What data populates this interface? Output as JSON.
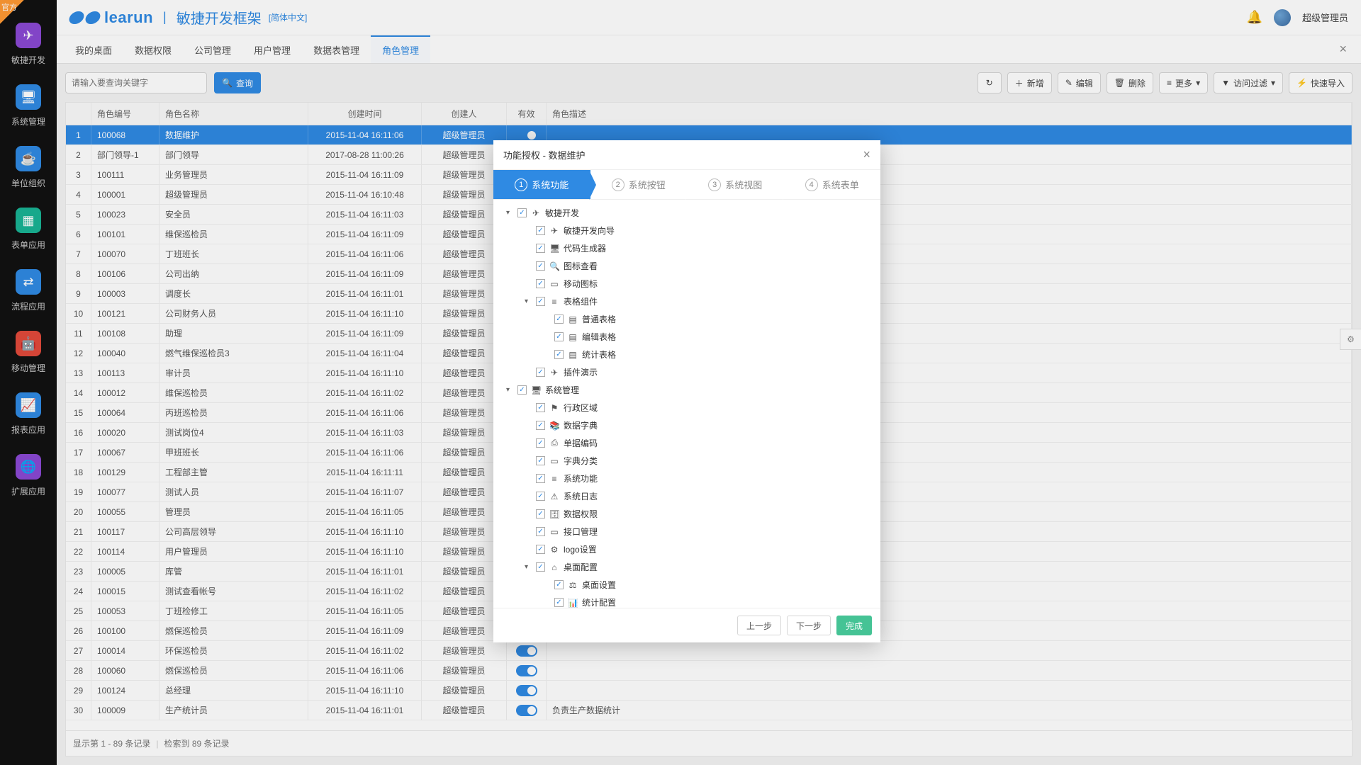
{
  "brand": {
    "name": "learun",
    "cn": "敏捷开发框架",
    "lang": "[简体中文]",
    "official": "官方"
  },
  "user": {
    "name": "超级管理员"
  },
  "sidebar": [
    {
      "label": "敏捷开发",
      "color": "#8b49d4",
      "icon": "send-icon",
      "glyph": "✈"
    },
    {
      "label": "系统管理",
      "color": "#2f8ae3",
      "icon": "monitor-icon",
      "glyph": "🖥"
    },
    {
      "label": "单位组织",
      "color": "#2f8ae3",
      "icon": "coffee-icon",
      "glyph": "☕"
    },
    {
      "label": "表单应用",
      "color": "#19b394",
      "icon": "grid-icon",
      "glyph": "▦"
    },
    {
      "label": "流程应用",
      "color": "#2f8ae3",
      "icon": "share-icon",
      "glyph": "⇄"
    },
    {
      "label": "移动管理",
      "color": "#e24a3b",
      "icon": "android-icon",
      "glyph": "🤖"
    },
    {
      "label": "报表应用",
      "color": "#2f8ae3",
      "icon": "chart-icon",
      "glyph": "📈"
    },
    {
      "label": "扩展应用",
      "color": "#8b49d4",
      "icon": "globe-icon",
      "glyph": "🌐"
    }
  ],
  "tabs": [
    "我的桌面",
    "数据权限",
    "公司管理",
    "用户管理",
    "数据表管理",
    "角色管理"
  ],
  "activeTab": 5,
  "search": {
    "placeholder": "请输入要查询关键字",
    "btn": "查询"
  },
  "toolbar": {
    "refresh": "↻",
    "add": "新增",
    "edit": "编辑",
    "del": "删除",
    "more": "更多",
    "filter": "访问过滤",
    "quick": "快速导入"
  },
  "columns": {
    "idx": "",
    "code": "角色编号",
    "name": "角色名称",
    "time": "创建时间",
    "creator": "创建人",
    "valid": "有效",
    "desc": "角色描述"
  },
  "rows": [
    {
      "i": 1,
      "code": "100068",
      "name": "数据维护",
      "time": "2015-11-04 16:11:06",
      "creator": "超级管理员",
      "valid": true,
      "desc": ""
    },
    {
      "i": 2,
      "code": "部门领导-1",
      "name": "部门领导",
      "time": "2017-08-28 11:00:26",
      "creator": "超级管理员",
      "valid": true,
      "desc": ""
    },
    {
      "i": 3,
      "code": "100111",
      "name": "业务管理员",
      "time": "2015-11-04 16:11:09",
      "creator": "超级管理员",
      "valid": true,
      "desc": ""
    },
    {
      "i": 4,
      "code": "100001",
      "name": "超级管理员",
      "time": "2015-11-04 16:10:48",
      "creator": "超级管理员",
      "valid": true,
      "desc": ""
    },
    {
      "i": 5,
      "code": "100023",
      "name": "安全员",
      "time": "2015-11-04 16:11:03",
      "creator": "超级管理员",
      "valid": true,
      "desc": ""
    },
    {
      "i": 6,
      "code": "100101",
      "name": "维保巡检员",
      "time": "2015-11-04 16:11:09",
      "creator": "超级管理员",
      "valid": true,
      "desc": ""
    },
    {
      "i": 7,
      "code": "100070",
      "name": "丁班班长",
      "time": "2015-11-04 16:11:06",
      "creator": "超级管理员",
      "valid": true,
      "desc": ""
    },
    {
      "i": 8,
      "code": "100106",
      "name": "公司出纳",
      "time": "2015-11-04 16:11:09",
      "creator": "超级管理员",
      "valid": true,
      "desc": ""
    },
    {
      "i": 9,
      "code": "100003",
      "name": "调度长",
      "time": "2015-11-04 16:11:01",
      "creator": "超级管理员",
      "valid": true,
      "desc": ""
    },
    {
      "i": 10,
      "code": "100121",
      "name": "公司财务人员",
      "time": "2015-11-04 16:11:10",
      "creator": "超级管理员",
      "valid": true,
      "desc": ""
    },
    {
      "i": 11,
      "code": "100108",
      "name": "助理",
      "time": "2015-11-04 16:11:09",
      "creator": "超级管理员",
      "valid": true,
      "desc": ""
    },
    {
      "i": 12,
      "code": "100040",
      "name": "燃气维保巡检员3",
      "time": "2015-11-04 16:11:04",
      "creator": "超级管理员",
      "valid": true,
      "desc": ""
    },
    {
      "i": 13,
      "code": "100113",
      "name": "审计员",
      "time": "2015-11-04 16:11:10",
      "creator": "超级管理员",
      "valid": true,
      "desc": ""
    },
    {
      "i": 14,
      "code": "100012",
      "name": "维保巡检员",
      "time": "2015-11-04 16:11:02",
      "creator": "超级管理员",
      "valid": true,
      "desc": ""
    },
    {
      "i": 15,
      "code": "100064",
      "name": "丙班巡检员",
      "time": "2015-11-04 16:11:06",
      "creator": "超级管理员",
      "valid": true,
      "desc": ""
    },
    {
      "i": 16,
      "code": "100020",
      "name": "测试岗位4",
      "time": "2015-11-04 16:11:03",
      "creator": "超级管理员",
      "valid": true,
      "desc": ""
    },
    {
      "i": 17,
      "code": "100067",
      "name": "甲班班长",
      "time": "2015-11-04 16:11:06",
      "creator": "超级管理员",
      "valid": true,
      "desc": ""
    },
    {
      "i": 18,
      "code": "100129",
      "name": "工程部主管",
      "time": "2015-11-04 16:11:11",
      "creator": "超级管理员",
      "valid": true,
      "desc": ""
    },
    {
      "i": 19,
      "code": "100077",
      "name": "测试人员",
      "time": "2015-11-04 16:11:07",
      "creator": "超级管理员",
      "valid": true,
      "desc": ""
    },
    {
      "i": 20,
      "code": "100055",
      "name": "管理员",
      "time": "2015-11-04 16:11:05",
      "creator": "超级管理员",
      "valid": true,
      "desc": ""
    },
    {
      "i": 21,
      "code": "100117",
      "name": "公司高层领导",
      "time": "2015-11-04 16:11:10",
      "creator": "超级管理员",
      "valid": true,
      "desc": ""
    },
    {
      "i": 22,
      "code": "100114",
      "name": "用户管理员",
      "time": "2015-11-04 16:11:10",
      "creator": "超级管理员",
      "valid": true,
      "desc": ""
    },
    {
      "i": 23,
      "code": "100005",
      "name": "库管",
      "time": "2015-11-04 16:11:01",
      "creator": "超级管理员",
      "valid": true,
      "desc": ""
    },
    {
      "i": 24,
      "code": "100015",
      "name": "测试查看帐号",
      "time": "2015-11-04 16:11:02",
      "creator": "超级管理员",
      "valid": true,
      "desc": ""
    },
    {
      "i": 25,
      "code": "100053",
      "name": "丁班检修工",
      "time": "2015-11-04 16:11:05",
      "creator": "超级管理员",
      "valid": true,
      "desc": ""
    },
    {
      "i": 26,
      "code": "100100",
      "name": "燃保巡检员",
      "time": "2015-11-04 16:11:09",
      "creator": "超级管理员",
      "valid": true,
      "desc": ""
    },
    {
      "i": 27,
      "code": "100014",
      "name": "环保巡检员",
      "time": "2015-11-04 16:11:02",
      "creator": "超级管理员",
      "valid": true,
      "desc": ""
    },
    {
      "i": 28,
      "code": "100060",
      "name": "燃保巡检员",
      "time": "2015-11-04 16:11:06",
      "creator": "超级管理员",
      "valid": true,
      "desc": ""
    },
    {
      "i": 29,
      "code": "100124",
      "name": "总经理",
      "time": "2015-11-04 16:11:10",
      "creator": "超级管理员",
      "valid": true,
      "desc": ""
    },
    {
      "i": 30,
      "code": "100009",
      "name": "生产统计员",
      "time": "2015-11-04 16:11:01",
      "creator": "超级管理员",
      "valid": true,
      "desc": "负责生产数据统计"
    }
  ],
  "selectedRow": 0,
  "footer": {
    "range": "显示第 1 - 89 条记录",
    "total": "检索到 89 条记录"
  },
  "modal": {
    "title": "功能授权 - 数据维护",
    "steps": [
      "系统功能",
      "系统按钮",
      "系统视图",
      "系统表单"
    ],
    "activeStep": 0,
    "prev": "上一步",
    "next": "下一步",
    "finish": "完成",
    "tree": [
      {
        "d": 0,
        "exp": "▾",
        "chk": true,
        "icon": "✈",
        "label": "敏捷开发"
      },
      {
        "d": 1,
        "exp": "",
        "chk": true,
        "icon": "✈",
        "label": "敏捷开发向导"
      },
      {
        "d": 1,
        "exp": "",
        "chk": true,
        "icon": "🖥",
        "label": "代码生成器"
      },
      {
        "d": 1,
        "exp": "",
        "chk": true,
        "icon": "🔍",
        "label": "图标查看"
      },
      {
        "d": 1,
        "exp": "",
        "chk": true,
        "icon": "▭",
        "label": "移动图标"
      },
      {
        "d": 1,
        "exp": "▾",
        "chk": true,
        "icon": "≡",
        "label": "表格组件"
      },
      {
        "d": 2,
        "exp": "",
        "chk": true,
        "icon": "▤",
        "label": "普通表格"
      },
      {
        "d": 2,
        "exp": "",
        "chk": true,
        "icon": "▤",
        "label": "编辑表格"
      },
      {
        "d": 2,
        "exp": "",
        "chk": true,
        "icon": "▤",
        "label": "统计表格"
      },
      {
        "d": 1,
        "exp": "",
        "chk": true,
        "icon": "✈",
        "label": "插件演示"
      },
      {
        "d": 0,
        "exp": "▾",
        "chk": true,
        "icon": "🖥",
        "label": "系统管理"
      },
      {
        "d": 1,
        "exp": "",
        "chk": true,
        "icon": "⚑",
        "label": "行政区域"
      },
      {
        "d": 1,
        "exp": "",
        "chk": true,
        "icon": "📚",
        "label": "数据字典"
      },
      {
        "d": 1,
        "exp": "",
        "chk": true,
        "icon": "⎙",
        "label": "单据编码"
      },
      {
        "d": 1,
        "exp": "",
        "chk": true,
        "icon": "▭",
        "label": "字典分类"
      },
      {
        "d": 1,
        "exp": "",
        "chk": true,
        "icon": "≡",
        "label": "系统功能"
      },
      {
        "d": 1,
        "exp": "",
        "chk": true,
        "icon": "⚠",
        "label": "系统日志"
      },
      {
        "d": 1,
        "exp": "",
        "chk": true,
        "icon": "🗄",
        "label": "数据权限"
      },
      {
        "d": 1,
        "exp": "",
        "chk": true,
        "icon": "▭",
        "label": "接口管理"
      },
      {
        "d": 1,
        "exp": "",
        "chk": true,
        "icon": "⚙",
        "label": "logo设置"
      },
      {
        "d": 1,
        "exp": "▾",
        "chk": true,
        "icon": "⌂",
        "label": "桌面配置"
      },
      {
        "d": 2,
        "exp": "",
        "chk": true,
        "icon": "⚖",
        "label": "桌面设置"
      },
      {
        "d": 2,
        "exp": "",
        "chk": true,
        "icon": "📊",
        "label": "统计配置"
      }
    ]
  }
}
